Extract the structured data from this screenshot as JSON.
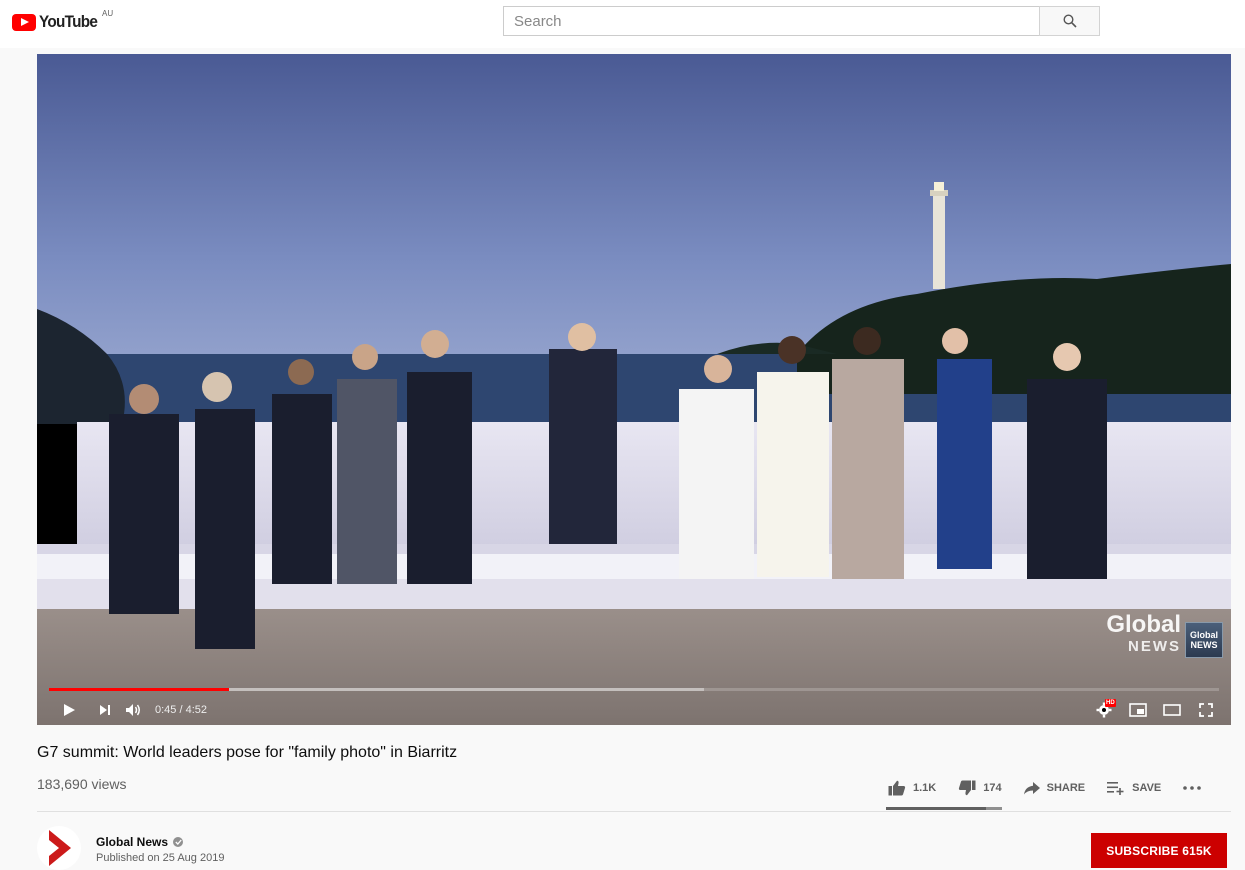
{
  "masthead": {
    "logo_text": "YouTube",
    "region": "AU",
    "search_placeholder": "Search"
  },
  "player": {
    "current_time": "0:45",
    "duration": "4:52",
    "time_display": "0:45 / 4:52",
    "progress_played_fraction": 0.154,
    "progress_loaded_fraction": 0.56,
    "watermark_brand": "Global",
    "watermark_sub": "NEWS",
    "watermark_badge_top": "Global",
    "watermark_badge_bottom": "NEWS",
    "quality_badge": "HD",
    "icons": [
      "play-icon",
      "next-icon",
      "volume-icon",
      "settings-icon",
      "miniplayer-icon",
      "theater-icon",
      "fullscreen-icon"
    ]
  },
  "video": {
    "title": "G7 summit: World leaders pose for \"family photo\" in Biarritz",
    "views": "183,690 views",
    "likes": "1.1K",
    "dislikes": "174",
    "share_label": "SHARE",
    "save_label": "SAVE",
    "like_ratio": 0.86
  },
  "channel": {
    "name": "Global News",
    "published": "Published on 25 Aug 2019",
    "subscribe_label": "SUBSCRIBE",
    "subscriber_count": "615K"
  },
  "colors": {
    "brand_red": "#ff0000",
    "subscribe_red": "#cc0000",
    "progress_red": "#ff0000"
  }
}
